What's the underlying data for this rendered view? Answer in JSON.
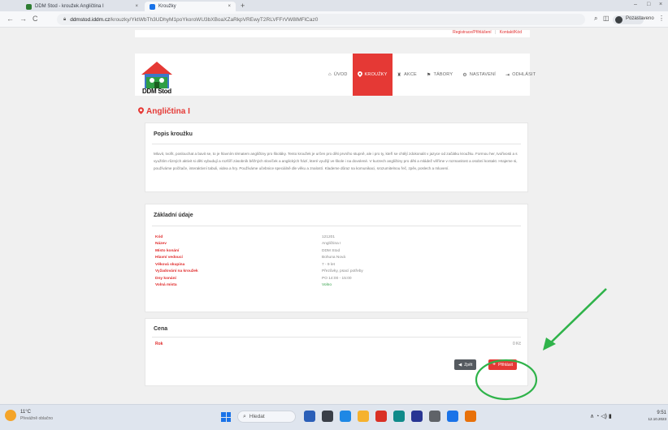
{
  "browser": {
    "tabs": [
      {
        "title": "DDM Stod - kroužek Angličtina I",
        "close": "×"
      },
      {
        "title": "Kroužky",
        "close": "×"
      }
    ],
    "new_tab": "+",
    "win_controls": {
      "minimize": "–",
      "maximize": "□",
      "close": "×"
    },
    "nav": {
      "back": "←",
      "forward": "→",
      "reload": "C"
    },
    "url_host": "ddmstod.iddm.cz",
    "url_path": "/krouzky/YktWbTh3UDhyM1poYkoroWU3bXBoaXZaRkpVREwyT2RLVFFrVW8lMFlCaz0",
    "profile_label": "Pozastaveno"
  },
  "site": {
    "top_links": {
      "register": "Registrace/Přihlášení",
      "contact": "Kontakt/Kód"
    },
    "logo_text": "DDM Stod",
    "brand_color": "#e53935",
    "menu": [
      {
        "icon": "home-icon",
        "glyph": "⌂",
        "label": "ÚVOD",
        "active": false
      },
      {
        "icon": "pin-icon",
        "glyph": "⬤",
        "label": "KROUŽKY",
        "active": true
      },
      {
        "icon": "trophy-icon",
        "glyph": "♜",
        "label": "AKCE",
        "active": false
      },
      {
        "icon": "flag-icon",
        "glyph": "⚑",
        "label": "TÁBORY",
        "active": false
      },
      {
        "icon": "gear-icon",
        "glyph": "⚙",
        "label": "NASTAVENÍ",
        "active": false
      },
      {
        "icon": "logout-icon",
        "glyph": "⇥",
        "label": "ODHLÁSIT",
        "active": false
      }
    ]
  },
  "course": {
    "title": "Angličtina I",
    "description_heading": "Popis kroužku",
    "description": "Mluvit, tvořit, poslouchat a bavit se, to je hlavním tématem angličtiny pro školáky. Tento kroužek je určen pro děti prvního stupně, ale i pro ty, kteří se chtějí zdokonalit v jazyce od začátku kroužku. Formou her, tvořivosti a s využitím různých aktivit si děti vybudují a rozšíří zásobník běžných slovíček a anglických frází, které využijí ve škole i na dovolené. V kurzech angličtiny pro děti a mládež věříme v rozmanitost a osobní kontakt. Hrajeme si, používáme počítače, interaktivní tabuli, videa a hry. Používáme učebnice speciálně dle věku a znalostí. Klademe důraz na komunikaci, srozumitelnou řeč, zpěv, poslech a mluvení.",
    "info_heading": "Základní údaje",
    "info": [
      {
        "label": "Kód",
        "value": "121201"
      },
      {
        "label": "Název",
        "value": "Angličtina I"
      },
      {
        "label": "Místo konání",
        "value": "DDM Stod"
      },
      {
        "label": "Hlavní vedoucí",
        "value": "Bohuna Nová"
      },
      {
        "label": "Věková skupina",
        "value": "7 - 9 let"
      },
      {
        "label": "Vyžadování na kroužek",
        "value": "Přezůvky, psací potřeby"
      },
      {
        "label": "Dny konání",
        "value": "PO 14:00 - 15:00"
      },
      {
        "label": "Volná místa",
        "value": "Volno"
      }
    ],
    "price_heading": "Cena",
    "price_label": "Rok",
    "price_value": "0 Kč",
    "back_button": "Zpět",
    "signup_button": "Přihlásit"
  },
  "taskbar": {
    "weather_temp": "11°C",
    "weather_desc": "Převážně oblačno",
    "search_placeholder": "Hledat",
    "clock_time": "9:51",
    "clock_date": "12.10.2023",
    "tray": "∧  ◔  ◁)  ▮"
  }
}
